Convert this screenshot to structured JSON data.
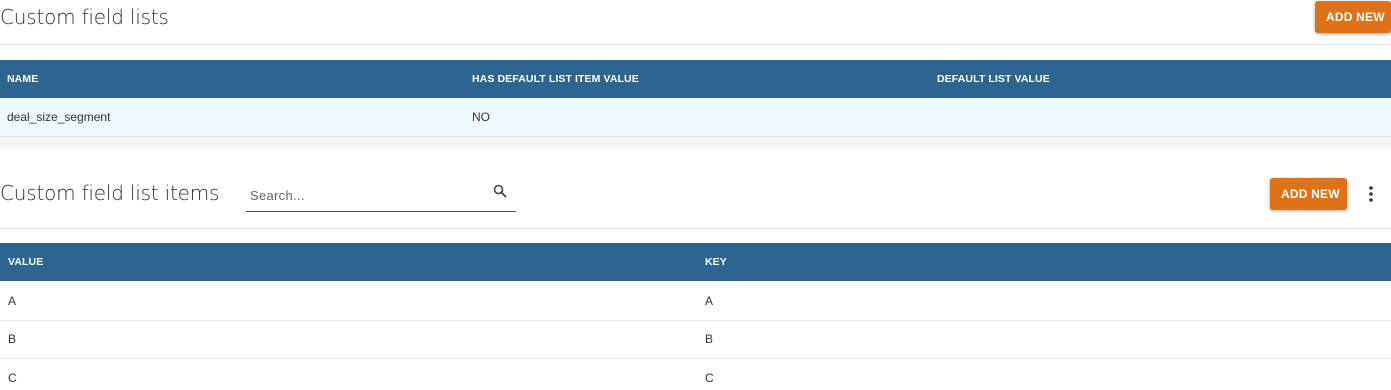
{
  "lists_section": {
    "title": "Custom field lists",
    "add_button_label": "ADD NEW",
    "columns": [
      "NAME",
      "HAS DEFAULT LIST ITEM VALUE",
      "DEFAULT LIST VALUE"
    ],
    "rows": [
      {
        "name": "deal_size_segment",
        "has_default": "NO",
        "default_value": ""
      }
    ]
  },
  "items_section": {
    "title": "Custom field list items",
    "search_placeholder": "Search...",
    "search_value": "",
    "add_button_label": "ADD NEW",
    "more_icon": "more-vertical-icon",
    "search_icon": "search-icon",
    "columns": [
      "VALUE",
      "KEY"
    ],
    "rows": [
      {
        "value": "A",
        "key": "A"
      },
      {
        "value": "B",
        "key": "B"
      },
      {
        "value": "C",
        "key": "C"
      }
    ]
  },
  "colors": {
    "header_bg": "#2c6690",
    "accent": "#e07116",
    "selected_row_bg": "#edf9fd"
  }
}
